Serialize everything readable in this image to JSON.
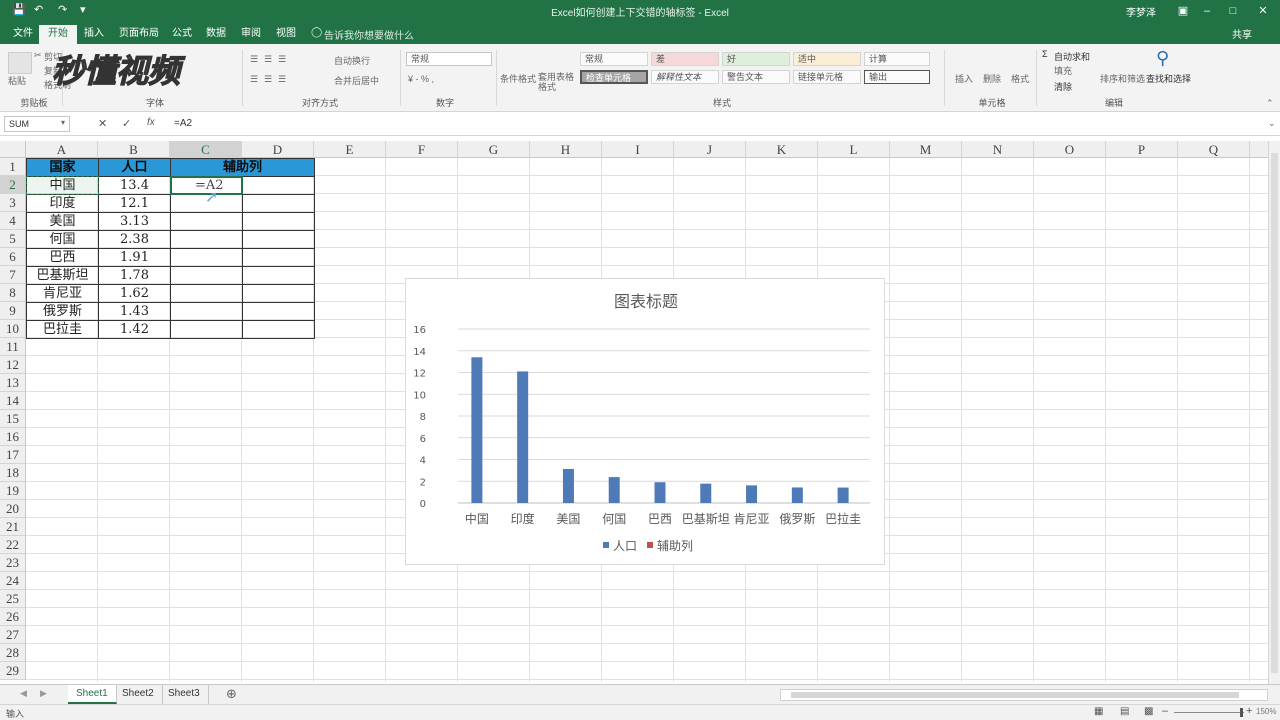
{
  "window": {
    "title": "Excel如何创建上下交错的轴标签 - Excel",
    "user": "李梦泽",
    "min_icon": "minimize-icon",
    "max_icon": "maximize-icon",
    "close_icon": "close-icon"
  },
  "quick_access": {
    "save_icon": "save-icon",
    "undo_icon": "undo-icon",
    "redo_icon": "redo-icon"
  },
  "tabs": [
    "文件",
    "开始",
    "插入",
    "页面布局",
    "公式",
    "数据",
    "审阅",
    "视图"
  ],
  "active_tab": "开始",
  "tell_me": "告诉我你想要做什么",
  "share": "共享",
  "watermark": "秒懂视频",
  "ribbon": {
    "clipboard": {
      "label": "剪贴板",
      "paste": "粘贴",
      "cut": "剪切",
      "copy": "复制",
      "format_painter": "格式刷"
    },
    "font": {
      "label": "字体"
    },
    "alignment": {
      "label": "对齐方式",
      "wrap": "自动换行",
      "merge": "合并后居中"
    },
    "number": {
      "label": "数字",
      "format": "常规"
    },
    "styles": {
      "label": "样式",
      "conditional": "条件格式",
      "table_format": "套用表格格式",
      "cells": [
        "常规",
        "差",
        "好",
        "适中",
        "计算",
        "检查单元格",
        "解释性文本",
        "警告文本",
        "链接单元格",
        "输出"
      ]
    },
    "cells": {
      "label": "单元格",
      "insert": "插入",
      "delete": "删除",
      "format": "格式"
    },
    "editing": {
      "label": "编辑",
      "autosum": "自动求和",
      "fill": "填充",
      "clear": "清除",
      "sort_filter": "排序和筛选",
      "find_select": "查找和选择"
    }
  },
  "formula_bar": {
    "name_box": "SUM",
    "formula": "=A2"
  },
  "columns": [
    "A",
    "B",
    "C",
    "D",
    "E",
    "F",
    "G",
    "H",
    "I",
    "J",
    "K",
    "L",
    "M",
    "N",
    "O",
    "P",
    "Q"
  ],
  "rows": [
    1,
    2,
    3,
    4,
    5,
    6,
    7,
    8,
    9,
    10,
    11,
    12,
    13,
    14,
    15,
    16,
    17,
    18,
    19,
    20,
    21,
    22,
    23,
    24,
    25,
    26,
    27,
    28,
    29
  ],
  "table": {
    "headers": [
      "国家",
      "人口",
      "辅助列"
    ],
    "rows": [
      [
        "中国",
        "13.4",
        "=A2"
      ],
      [
        "印度",
        "12.1",
        ""
      ],
      [
        "美国",
        "3.13",
        ""
      ],
      [
        "何国",
        "2.38",
        ""
      ],
      [
        "巴西",
        "1.91",
        ""
      ],
      [
        "巴基斯坦",
        "1.78",
        ""
      ],
      [
        "肯尼亚",
        "1.62",
        ""
      ],
      [
        "俄罗斯",
        "1.43",
        ""
      ],
      [
        "巴拉圭",
        "1.42",
        ""
      ]
    ]
  },
  "chart_data": {
    "type": "bar",
    "title": "图表标题",
    "categories": [
      "中国",
      "印度",
      "美国",
      "何国",
      "巴西",
      "巴基斯坦",
      "肯尼亚",
      "俄罗斯",
      "巴拉圭"
    ],
    "series": [
      {
        "name": "人口",
        "values": [
          13.4,
          12.1,
          3.13,
          2.38,
          1.91,
          1.78,
          1.62,
          1.43,
          1.42
        ],
        "color": "#4f7ab8"
      },
      {
        "name": "辅助列",
        "values": [],
        "color": "#c0504d"
      }
    ],
    "ylim": [
      0,
      16
    ],
    "yticks": [
      0,
      2,
      4,
      6,
      8,
      10,
      12,
      14,
      16
    ],
    "grid": true,
    "legend": "bottom"
  },
  "sheets": [
    "Sheet1",
    "Sheet2",
    "Sheet3"
  ],
  "active_sheet": "Sheet1",
  "status": {
    "mode": "输入",
    "zoom": "150%"
  },
  "colors": {
    "excel_green": "#217346",
    "header_fill": "#2a97d6"
  }
}
